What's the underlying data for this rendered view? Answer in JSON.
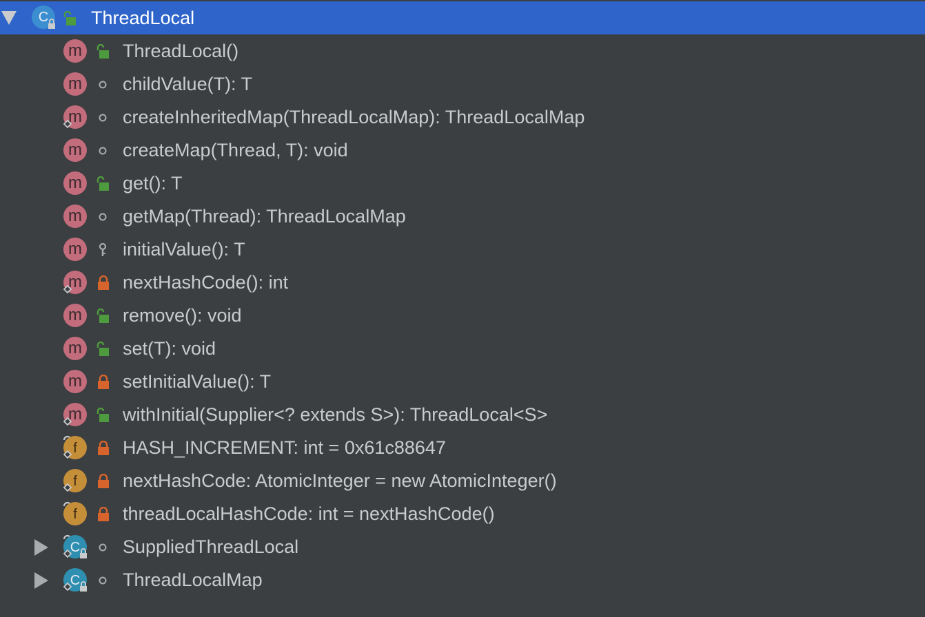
{
  "colors": {
    "background": "#3c3f41",
    "selection": "#2f65ca",
    "method_badge": "#c26c7c",
    "field_badge": "#c58f3a",
    "class_badge": "#3b8fd0",
    "inner_class_badge": "#2e8fb0",
    "public_lock": "#4e9a3e",
    "private_lock": "#d7642c",
    "package_dot": "#a9abad"
  },
  "tree": {
    "root": {
      "label": "ThreadLocal",
      "expanded": true,
      "kind": "class",
      "kind_letter": "C",
      "visibility": "public"
    },
    "members": [
      {
        "label": "ThreadLocal()",
        "kind": "method",
        "kind_letter": "m",
        "visibility": "public",
        "static": false
      },
      {
        "label": "childValue(T): T",
        "kind": "method",
        "kind_letter": "m",
        "visibility": "package",
        "static": false
      },
      {
        "label": "createInheritedMap(ThreadLocalMap): ThreadLocalMap",
        "kind": "method",
        "kind_letter": "m",
        "visibility": "package",
        "static": true
      },
      {
        "label": "createMap(Thread, T): void",
        "kind": "method",
        "kind_letter": "m",
        "visibility": "package",
        "static": false
      },
      {
        "label": "get(): T",
        "kind": "method",
        "kind_letter": "m",
        "visibility": "public",
        "static": false
      },
      {
        "label": "getMap(Thread): ThreadLocalMap",
        "kind": "method",
        "kind_letter": "m",
        "visibility": "package",
        "static": false
      },
      {
        "label": "initialValue(): T",
        "kind": "method",
        "kind_letter": "m",
        "visibility": "protected",
        "static": false
      },
      {
        "label": "nextHashCode(): int",
        "kind": "method",
        "kind_letter": "m",
        "visibility": "private",
        "static": true
      },
      {
        "label": "remove(): void",
        "kind": "method",
        "kind_letter": "m",
        "visibility": "public",
        "static": false
      },
      {
        "label": "set(T): void",
        "kind": "method",
        "kind_letter": "m",
        "visibility": "public",
        "static": false
      },
      {
        "label": "setInitialValue(): T",
        "kind": "method",
        "kind_letter": "m",
        "visibility": "private",
        "static": false
      },
      {
        "label": "withInitial(Supplier<? extends S>): ThreadLocal<S>",
        "kind": "method",
        "kind_letter": "m",
        "visibility": "public",
        "static": true
      },
      {
        "label": "HASH_INCREMENT: int = 0x61c88647",
        "kind": "field",
        "kind_letter": "f",
        "visibility": "private",
        "static": true,
        "final": true
      },
      {
        "label": "nextHashCode: AtomicInteger = new AtomicInteger()",
        "kind": "field",
        "kind_letter": "f",
        "visibility": "private",
        "static": true,
        "final": false
      },
      {
        "label": "threadLocalHashCode: int = nextHashCode()",
        "kind": "field",
        "kind_letter": "f",
        "visibility": "private",
        "static": false,
        "final": true
      },
      {
        "label": "SuppliedThreadLocal",
        "kind": "inner-class",
        "kind_letter": "C",
        "visibility": "package",
        "static": true,
        "final": true,
        "expanded": false
      },
      {
        "label": "ThreadLocalMap",
        "kind": "inner-class",
        "kind_letter": "C",
        "visibility": "package",
        "static": true,
        "final": false,
        "expanded": false
      }
    ]
  }
}
